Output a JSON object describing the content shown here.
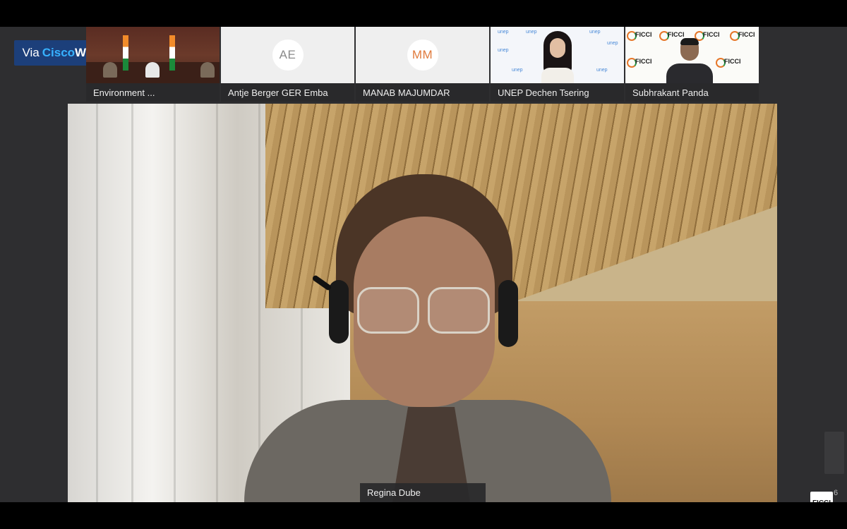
{
  "brand": {
    "via": "Via",
    "cisco": "Cisco",
    "webex": "Webex"
  },
  "participants": [
    {
      "name": "Environment ...",
      "type": "video"
    },
    {
      "name": "Antje Berger GER Emba",
      "initials": "AE",
      "initials_color": "#8a8a8a",
      "type": "avatar"
    },
    {
      "name": "MANAB MAJUMDAR",
      "initials": "MM",
      "initials_color": "#e07a3c",
      "type": "avatar"
    },
    {
      "name": "UNEP Dechen Tsering",
      "type": "video",
      "backdrop_text": "unep"
    },
    {
      "name": "Subhrakant Panda",
      "type": "video",
      "backdrop_text": "FICCI"
    }
  ],
  "active_speaker": {
    "name": "Regina Dube"
  },
  "corner": {
    "logo_text": "FICCI",
    "number": "6"
  },
  "colors": {
    "brand_bg": "#1c3f7a",
    "cisco_blue": "#37b2ff",
    "stage_bg": "#2e2e30"
  }
}
